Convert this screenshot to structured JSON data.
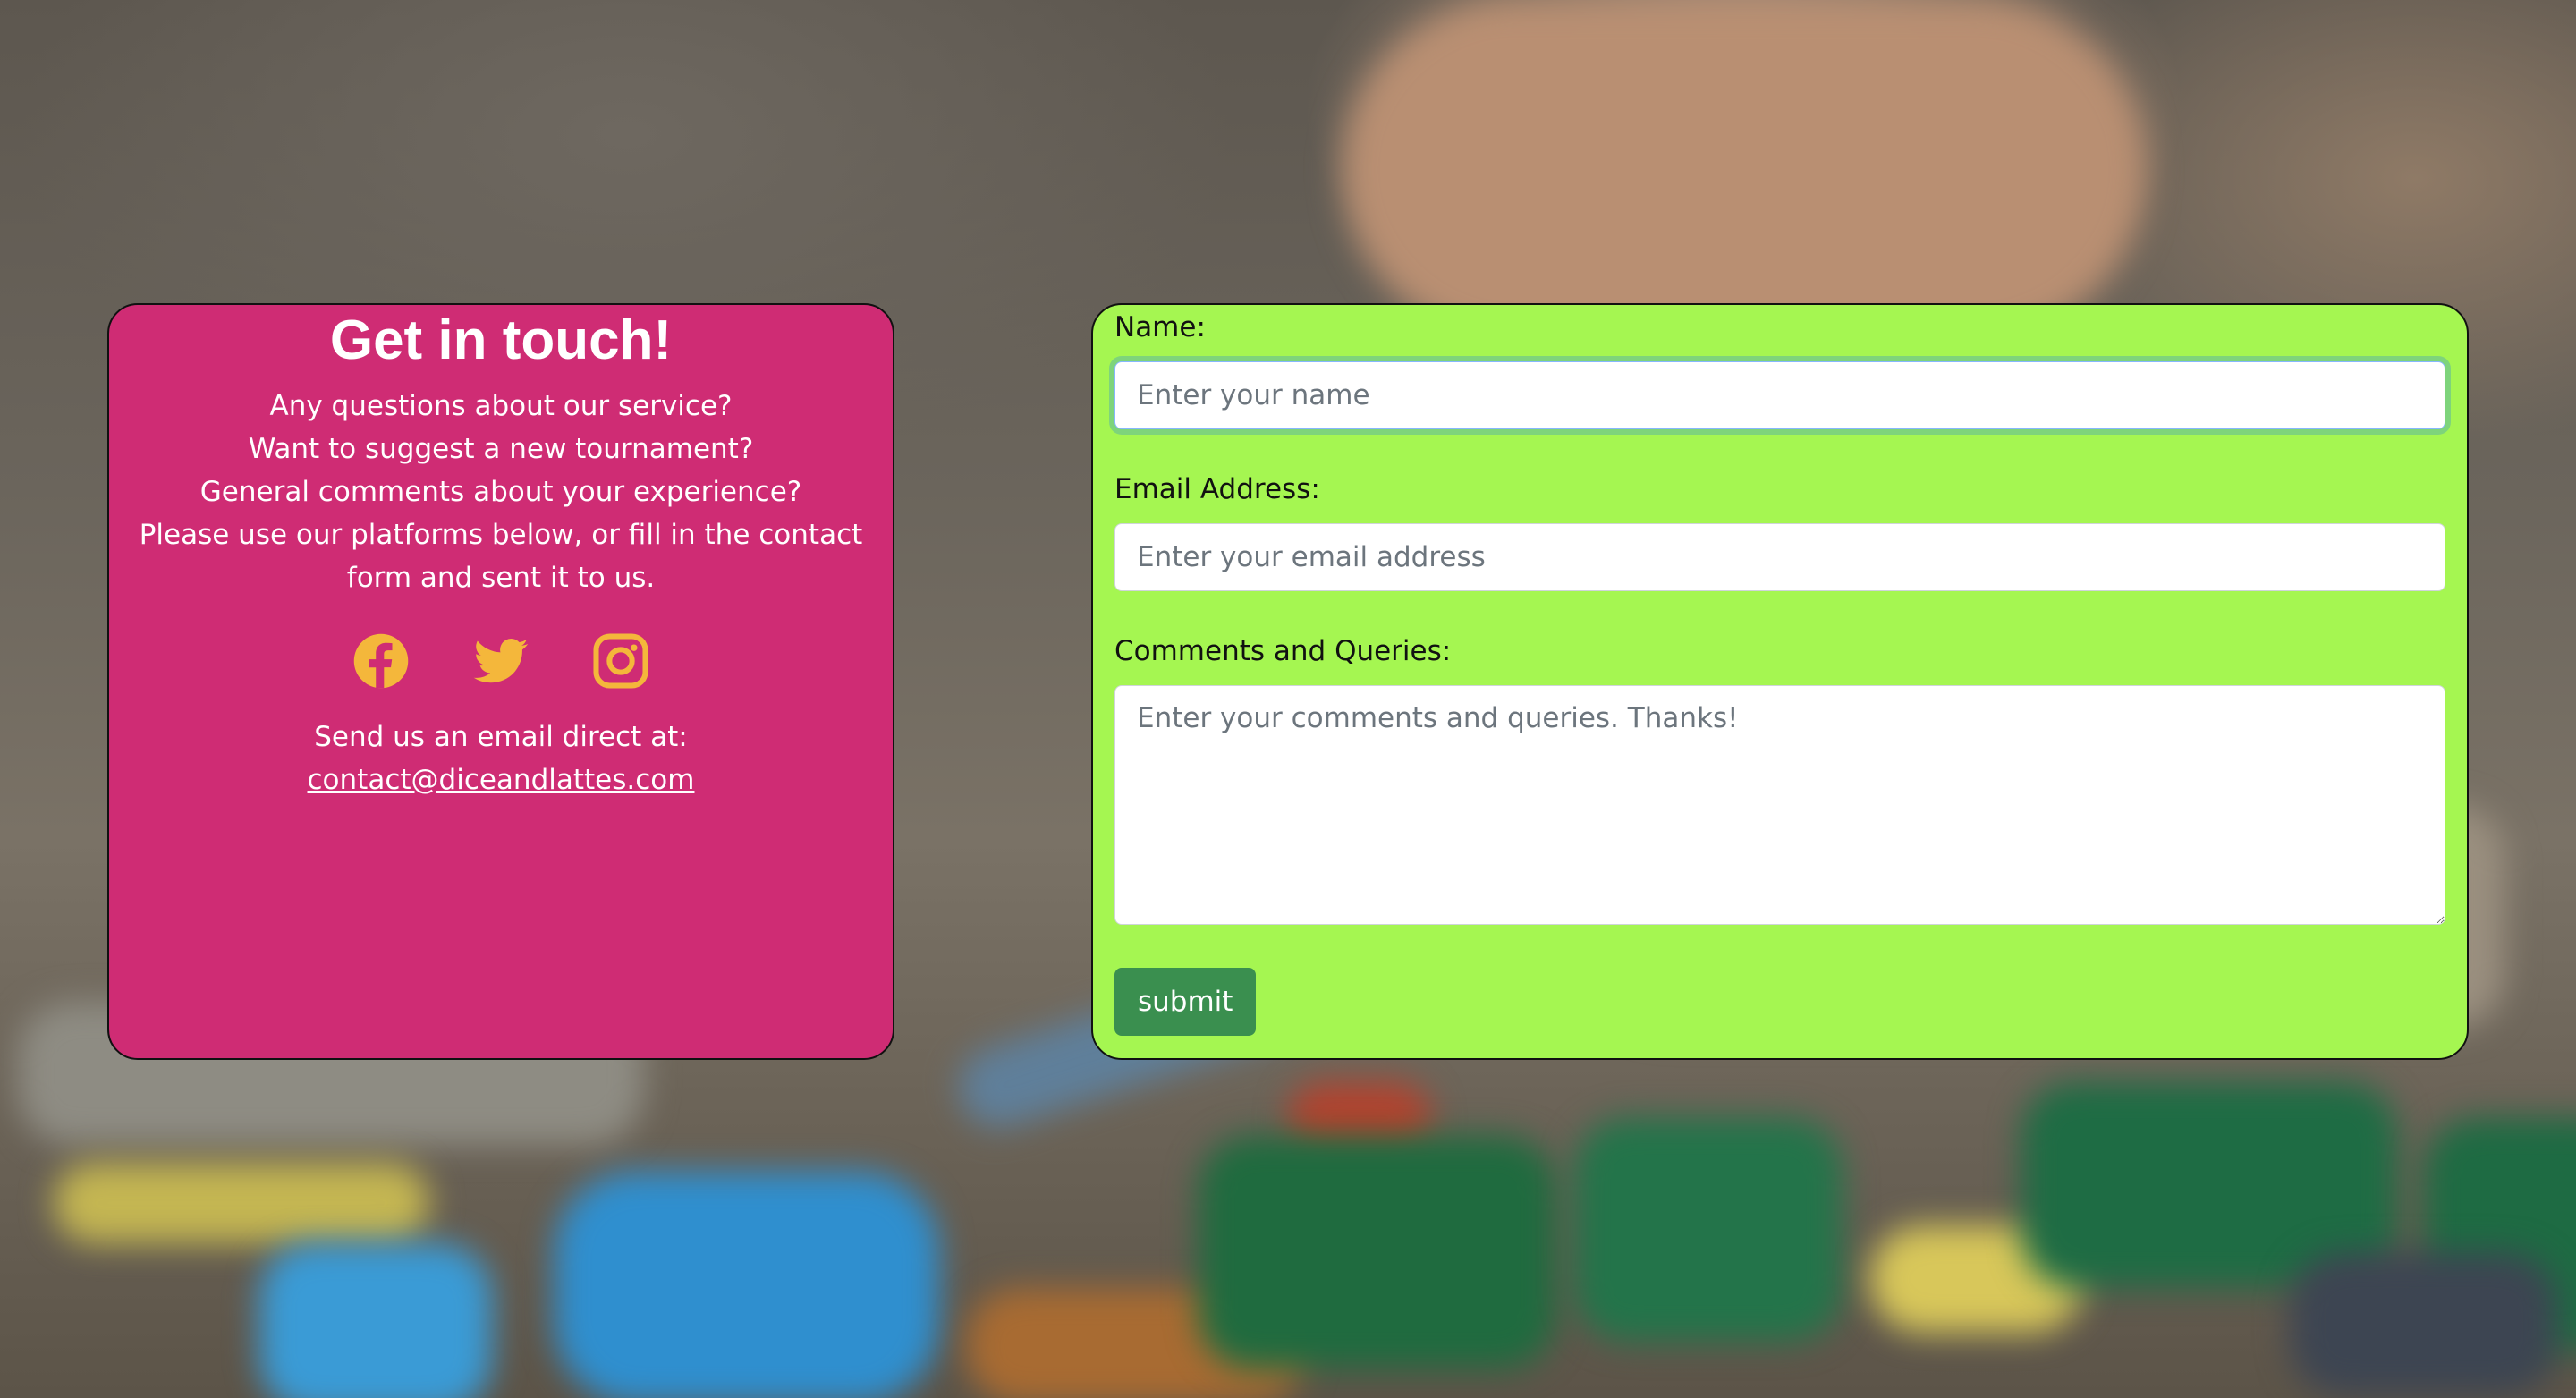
{
  "contact_info": {
    "title": "Get in touch!",
    "lines": [
      "Any questions about our service?",
      "Want to suggest a new tournament?",
      "General comments about your experience?",
      "Please use our platforms below, or fill in the contact",
      "form and sent it to us."
    ],
    "social_icons": [
      "facebook-icon",
      "twitter-icon",
      "instagram-icon"
    ],
    "email_label": "Send us an email direct at:",
    "email_address": "contact@diceandlattes.com"
  },
  "form": {
    "name_label": "Name:",
    "name_placeholder": "Enter your name",
    "email_label": "Email Address:",
    "email_placeholder": "Enter your email address",
    "comments_label": "Comments and Queries:",
    "comments_placeholder": "Enter your comments and queries. Thanks!",
    "submit_label": "submit"
  },
  "colors": {
    "info_card": "#cf2c74",
    "form_card": "#a5f651",
    "icon_color": "#f4b73b",
    "submit_button": "#3a8f4f"
  }
}
